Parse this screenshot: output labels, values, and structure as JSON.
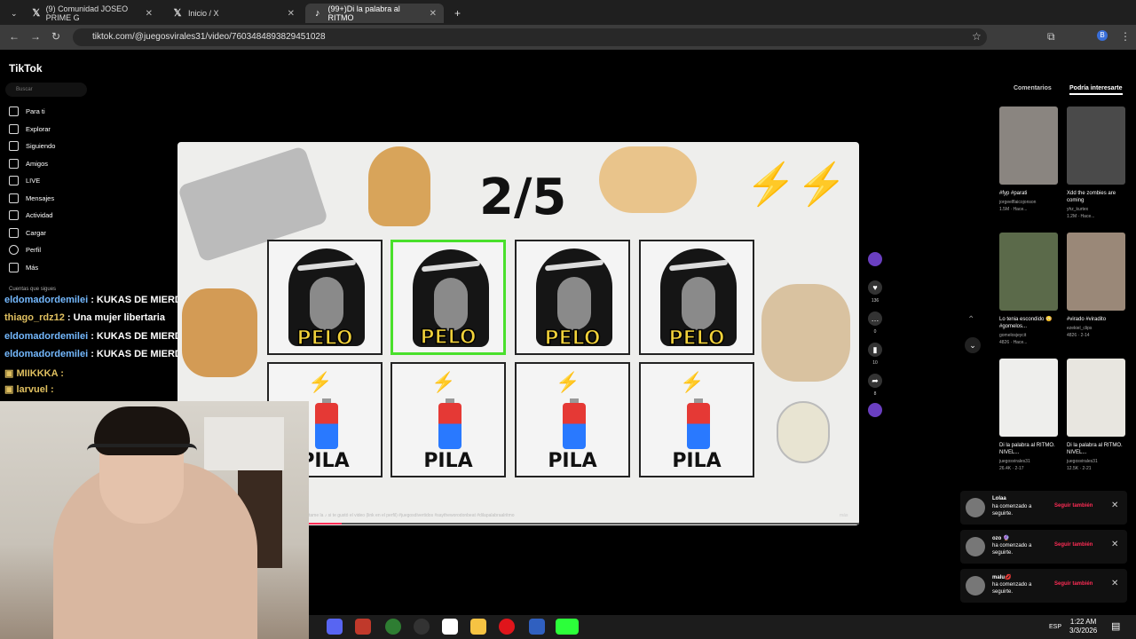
{
  "browser": {
    "tabs": [
      {
        "label": "(9) Comunidad JOSEO PRIME G",
        "icon": "x-icon"
      },
      {
        "label": "Inicio / X",
        "icon": "x-icon"
      },
      {
        "label": "(99+)Di la palabra al RITMO",
        "icon": "tiktok-icon"
      }
    ],
    "url": "tiktok.com/@juegosvirales31/video/7603484893829451028"
  },
  "sidebar": {
    "logo": "TikTok",
    "search_placeholder": "Buscar",
    "items": [
      {
        "label": "Para ti"
      },
      {
        "label": "Explorar"
      },
      {
        "label": "Siguiendo"
      },
      {
        "label": "Amigos"
      },
      {
        "label": "LIVE"
      },
      {
        "label": "Mensajes"
      },
      {
        "label": "Actividad"
      },
      {
        "label": "Cargar"
      },
      {
        "label": "Perfil"
      },
      {
        "label": "Más"
      }
    ],
    "following_header": "Cuentas que sigues"
  },
  "chat": [
    {
      "user": "eldomadordemilei",
      "msg": ": KUKAS DE MIERDA"
    },
    {
      "user": "thiago_rdz12",
      "msg": ": Una mujer libertaria"
    },
    {
      "user": "eldomadordemilei",
      "msg": ": KUKAS DE MIERDA"
    },
    {
      "user": "eldomadordemilei",
      "msg": ": KUKAS DE MIERDA"
    },
    {
      "user": "MIIKKKA",
      "msg": ":"
    },
    {
      "user": "larvuel",
      "msg": ":"
    }
  ],
  "video": {
    "counter": "2/5",
    "row1": [
      "PELO",
      "PELO",
      "PELO",
      "PELO"
    ],
    "row2": [
      "PILA",
      "PILA",
      "PILA",
      "PILA"
    ],
    "caption": "tame la ♪ si te gustó el video (link en el perfil) #juegosdivertidos #saytheworodonbeat #dilapalabraalritmo",
    "more": "más",
    "progress": 0.06
  },
  "actions": {
    "likes": "136",
    "comments": "0",
    "saves": "10",
    "shares": "8"
  },
  "right_panel": {
    "tabs": [
      "Comentarios",
      "Podría interesarte"
    ],
    "videos": [
      {
        "caption": "#fyp #parati",
        "author": "jorgeelflaicojonson",
        "meta": "1.5M · Hace..."
      },
      {
        "caption": "Xdd the zombies are coming",
        "author": "yhz_kurtex",
        "meta": "1.2M · Hace..."
      },
      {
        "caption": "Lo tenia escondido 😳 #gomelos...",
        "author": "gomelosjeycit",
        "meta": "4826 · Hace..."
      },
      {
        "caption": "#virado #viradito",
        "author": "ezekiel_clips",
        "meta": "4826 · 2-14"
      },
      {
        "caption": "Di la palabra al RITMO. NIVEL...",
        "author": "juegosvirales31",
        "meta": "26.4K · 2-17"
      },
      {
        "caption": "Di la palabra al RITMO. NIVEL...",
        "author": "juegosvirales31",
        "meta": "12.5K · 2-21"
      }
    ]
  },
  "notifications": [
    {
      "name": "Lolaa",
      "msg": "ha comenzado a seguirte.",
      "action": "Seguir también"
    },
    {
      "name": "ozo 🔮",
      "msg": "ha comenzado a seguirte.",
      "action": "Seguir también"
    },
    {
      "name": "malu💋",
      "msg": "ha comenzado a seguirte.",
      "action": "Seguir también"
    }
  ],
  "taskbar": {
    "time": "1:22 AM",
    "date": "3/3/2026",
    "lang": "ESP"
  }
}
